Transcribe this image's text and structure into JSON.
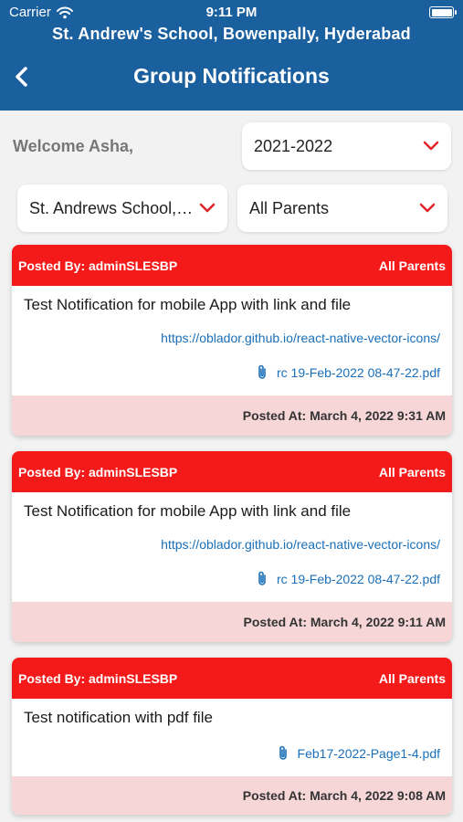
{
  "status": {
    "carrier": "Carrier",
    "time": "9:11 PM"
  },
  "header": {
    "school": "St. Andrew's School, Bowenpally, Hyderabad",
    "title": "Group Notifications"
  },
  "welcome": "Welcome Asha,",
  "filters": {
    "year": "2021-2022",
    "school": "St. Andrews School, Bowenpally",
    "audience": "All Parents"
  },
  "notifications": [
    {
      "posted_by": "Posted By: adminSLESBP",
      "audience": "All Parents",
      "message": "Test Notification for mobile App with link and file",
      "link": "https://oblador.github.io/react-native-vector-icons/",
      "file": "rc 19-Feb-2022 08-47-22.pdf",
      "posted_at": "Posted At: March 4, 2022 9:31 AM"
    },
    {
      "posted_by": "Posted By: adminSLESBP",
      "audience": "All Parents",
      "message": "Test Notification for mobile App with link and file",
      "link": "https://oblador.github.io/react-native-vector-icons/",
      "file": "rc 19-Feb-2022 08-47-22.pdf",
      "posted_at": "Posted At: March 4, 2022 9:11 AM"
    },
    {
      "posted_by": "Posted By: adminSLESBP",
      "audience": "All Parents",
      "message": "Test notification with pdf file",
      "file": "Feb17-2022-Page1-4.pdf",
      "posted_at": "Posted At: March 4, 2022 9:08 AM"
    }
  ],
  "colors": {
    "header": "#1a5f9e",
    "card_header": "#f51a1a",
    "card_footer": "#f7d6d8",
    "link": "#1a6fb8",
    "chevron": "#e0242b"
  }
}
